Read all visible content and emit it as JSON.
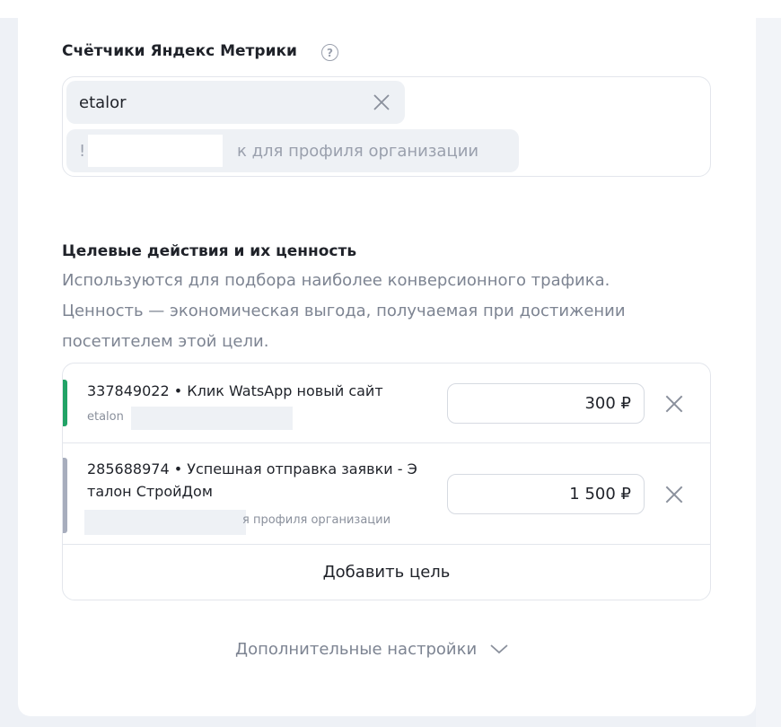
{
  "counters": {
    "title": "Счётчики Яндекс Метрики",
    "help_symbol": "?",
    "chips": [
      {
        "label": "etalor"
      },
      {
        "label": "!",
        "suffix": "к для профиля организации"
      }
    ]
  },
  "goals": {
    "title": "Целевые действия и их ценность",
    "description_line1": "Используются для подбора наиболее конверсионного трафика.",
    "description_line2": "Ценность — экономическая выгода, получаемая при достижении",
    "description_line3": "посетителем этой цели.",
    "items": [
      {
        "name": "337849022 • Клик WatsApp новый сайт",
        "sub": "etalon",
        "value": "300 ₽",
        "bar_color": "#21a366"
      },
      {
        "name_line1": "285688974 • Успешная отправка заявки - Э",
        "name_line2": "талон СтройДом",
        "sub": "я профиля организации",
        "value": "1 500 ₽",
        "bar_color": "#a7adbd"
      }
    ],
    "add_label": "Добавить цель"
  },
  "more_settings": {
    "label": "Дополнительные настройки"
  }
}
